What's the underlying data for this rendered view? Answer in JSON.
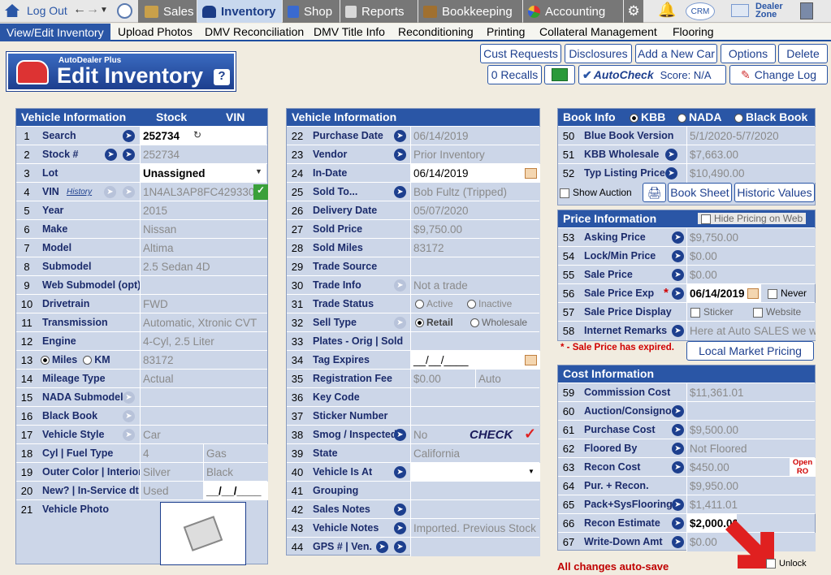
{
  "topnav": {
    "logout": "Log Out",
    "sales": "Sales",
    "inventory": "Inventory",
    "shop": "Shop",
    "reports": "Reports",
    "bookkeeping": "Bookkeeping",
    "accounting": "Accounting",
    "crm": "CRM",
    "dealer_zone_1": "Dealer",
    "dealer_zone_2": "Zone"
  },
  "subnav": [
    "View/Edit Inventory",
    "Upload Photos",
    "DMV Reconciliation",
    "DMV Title Info",
    "Reconditioning",
    "Printing",
    "Collateral Management",
    "Flooring"
  ],
  "logo": {
    "small": "AutoDealer Plus",
    "big": "Edit Inventory",
    "help": "?"
  },
  "buttons": {
    "cust_requests": "Cust Requests",
    "disclosures": "Disclosures",
    "add_car": "Add a New Car",
    "options": "Options",
    "delete": "Delete",
    "recalls": "0 Recalls",
    "autocheck": "AutoCheck",
    "score": "Score:  N/A",
    "change_log": "Change Log"
  },
  "left": {
    "h1": "Vehicle Information",
    "h2": "Stock",
    "h3": "VIN",
    "history": "History",
    "miles": "Miles",
    "km": "KM",
    "rows": [
      {
        "n": "1",
        "l": "Search",
        "v": "252734",
        "v2": ""
      },
      {
        "n": "2",
        "l": "Stock #",
        "v": "252734",
        "v2": ""
      },
      {
        "n": "3",
        "l": "Lot",
        "v": "Unassigned",
        "v2": ""
      },
      {
        "n": "4",
        "l": "VIN",
        "v": "1N4AL3AP8FC429330",
        "v2": ""
      },
      {
        "n": "5",
        "l": "Year",
        "v": "2015",
        "v2": ""
      },
      {
        "n": "6",
        "l": "Make",
        "v": "Nissan",
        "v2": ""
      },
      {
        "n": "7",
        "l": "Model",
        "v": "Altima",
        "v2": ""
      },
      {
        "n": "8",
        "l": "Submodel",
        "v": "2.5 Sedan 4D",
        "v2": ""
      },
      {
        "n": "9",
        "l": "Web Submodel (opt)",
        "v": "",
        "v2": ""
      },
      {
        "n": "10",
        "l": "Drivetrain",
        "v": "FWD",
        "v2": ""
      },
      {
        "n": "11",
        "l": "Transmission",
        "v": "Automatic, Xtronic CVT",
        "v2": ""
      },
      {
        "n": "12",
        "l": "Engine",
        "v": "4-Cyl, 2.5 Liter",
        "v2": ""
      },
      {
        "n": "13",
        "l": "",
        "v": "83172",
        "v2": ""
      },
      {
        "n": "14",
        "l": "Mileage Type",
        "v": "Actual",
        "v2": ""
      },
      {
        "n": "15",
        "l": "NADA Submodel",
        "v": "",
        "v2": ""
      },
      {
        "n": "16",
        "l": "Black Book",
        "v": "",
        "v2": ""
      },
      {
        "n": "17",
        "l": "Vehicle Style",
        "v": "Car",
        "v2": ""
      },
      {
        "n": "18",
        "l": "Cyl | Fuel Type",
        "v": "4",
        "v2": "Gas"
      },
      {
        "n": "19",
        "l": "Outer Color | Interior",
        "v": "Silver",
        "v2": "Black"
      },
      {
        "n": "20",
        "l": "New? | In-Service dt",
        "v": "Used",
        "v2": "__/__/____"
      },
      {
        "n": "21",
        "l": "Vehicle Photo",
        "v": "",
        "v2": ""
      }
    ]
  },
  "mid": {
    "h1": "Vehicle Information",
    "active": "Active",
    "inactive": "Inactive",
    "retail": "Retail",
    "wholesale": "Wholesale",
    "check": "CHECK",
    "rows": [
      {
        "n": "22",
        "l": "Purchase Date",
        "v": "06/14/2019",
        "v2": ""
      },
      {
        "n": "23",
        "l": "Vendor",
        "v": "Prior Inventory",
        "v2": ""
      },
      {
        "n": "24",
        "l": "In-Date",
        "v": "06/14/2019",
        "v2": ""
      },
      {
        "n": "25",
        "l": "Sold To...",
        "v": "Bob Fultz (Tripped)",
        "v2": ""
      },
      {
        "n": "26",
        "l": "Delivery Date",
        "v": "05/07/2020",
        "v2": ""
      },
      {
        "n": "27",
        "l": "Sold Price",
        "v": "$9,750.00",
        "v2": ""
      },
      {
        "n": "28",
        "l": "Sold Miles",
        "v": "83172",
        "v2": ""
      },
      {
        "n": "29",
        "l": "Trade Source",
        "v": "",
        "v2": ""
      },
      {
        "n": "30",
        "l": "Trade Info",
        "v": "Not a trade",
        "v2": ""
      },
      {
        "n": "31",
        "l": "Trade Status",
        "v": "",
        "v2": ""
      },
      {
        "n": "32",
        "l": "Sell Type",
        "v": "",
        "v2": ""
      },
      {
        "n": "33",
        "l": "Plates - Orig | Sold",
        "v": "",
        "v2": ""
      },
      {
        "n": "34",
        "l": "Tag Expires",
        "v": "__/__/____",
        "v2": ""
      },
      {
        "n": "35",
        "l": "Registration Fee",
        "v": "$0.00",
        "v2": "Auto"
      },
      {
        "n": "36",
        "l": "Key Code",
        "v": "",
        "v2": ""
      },
      {
        "n": "37",
        "l": "Sticker Number",
        "v": "",
        "v2": ""
      },
      {
        "n": "38",
        "l": "Smog / Inspected",
        "v": "No",
        "v2": ""
      },
      {
        "n": "39",
        "l": "State",
        "v": "California",
        "v2": ""
      },
      {
        "n": "40",
        "l": "Vehicle Is At",
        "v": "",
        "v2": ""
      },
      {
        "n": "41",
        "l": "Grouping",
        "v": "",
        "v2": ""
      },
      {
        "n": "42",
        "l": "Sales Notes",
        "v": "",
        "v2": ""
      },
      {
        "n": "43",
        "l": "Vehicle Notes",
        "v": "Imported.  Previous Stock",
        "v2": ""
      },
      {
        "n": "44",
        "l": "GPS # | Ven.",
        "v": "",
        "v2": ""
      }
    ]
  },
  "book": {
    "h1": "Book Info",
    "kbb": "KBB",
    "nada": "NADA",
    "bb": "Black Book",
    "show_auction": "Show Auction",
    "book_sheet": "Book Sheet",
    "historic": "Historic Values",
    "rows": [
      {
        "n": "50",
        "l": "Blue Book Version",
        "v": "5/1/2020-5/7/2020"
      },
      {
        "n": "51",
        "l": "KBB Wholesale",
        "v": "$7,663.00"
      },
      {
        "n": "52",
        "l": "Typ Listing Price",
        "v": "$10,490.00"
      }
    ]
  },
  "price": {
    "h1": "Price Information",
    "hide": "Hide Pricing on Web",
    "never": "Never",
    "sticker": "Sticker",
    "website": "Website",
    "expired_note": "* - Sale Price has expired.",
    "local": "Local Market Pricing",
    "star": "*",
    "rows": [
      {
        "n": "53",
        "l": "Asking Price",
        "v": "$9,750.00"
      },
      {
        "n": "54",
        "l": "Lock/Min Price",
        "v": "$0.00"
      },
      {
        "n": "55",
        "l": "Sale Price",
        "v": "$0.00"
      },
      {
        "n": "56",
        "l": "Sale Price Exp",
        "v": "06/14/2019"
      },
      {
        "n": "57",
        "l": "Sale Price Display",
        "v": ""
      },
      {
        "n": "58",
        "l": "Internet Remarks",
        "v": "Here at Auto SALES we w"
      }
    ]
  },
  "cost": {
    "h1": "Cost Information",
    "open_ro_1": "Open",
    "open_ro_2": "RO",
    "rows": [
      {
        "n": "59",
        "l": "Commission Cost",
        "v": "$11,361.01"
      },
      {
        "n": "60",
        "l": "Auction/Consignor",
        "v": ""
      },
      {
        "n": "61",
        "l": "Purchase Cost",
        "v": "$9,500.00"
      },
      {
        "n": "62",
        "l": "Floored By",
        "v": "Not Floored"
      },
      {
        "n": "63",
        "l": "Recon Cost",
        "v": "$450.00"
      },
      {
        "n": "64",
        "l": "Pur. + Recon.",
        "v": "$9,950.00"
      },
      {
        "n": "65",
        "l": "Pack+SysFlooring",
        "v": "$1,411.01"
      },
      {
        "n": "66",
        "l": "Recon Estimate",
        "v": "$2,000.00"
      },
      {
        "n": "67",
        "l": "Write-Down Amt",
        "v": "$0.00"
      }
    ]
  },
  "footer": {
    "autosave": "All changes auto-save",
    "unlock": "Unlock"
  }
}
